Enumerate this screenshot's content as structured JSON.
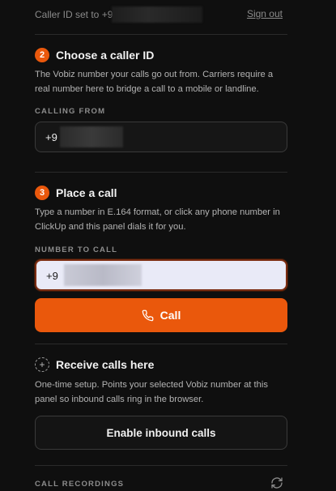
{
  "header": {
    "caller_id_text": "Caller ID set to +91",
    "sign_out_label": "Sign out"
  },
  "step_caller": {
    "number": "2",
    "title": "Choose a caller ID",
    "description": "The Vobiz number your calls go out from. Carriers require a real number here to bridge a call to a mobile or landline.",
    "field_label": "CALLING FROM",
    "value": "+9"
  },
  "step_call": {
    "number": "3",
    "title": "Place a call",
    "description": "Type a number in E.164 format, or click any phone number in ClickUp and this panel dials it for you.",
    "field_label": "NUMBER TO CALL",
    "value": "+9",
    "call_label": "Call"
  },
  "step_receive": {
    "number": "+",
    "title": "Receive calls here",
    "description": "One-time setup. Points your selected Vobiz number at this panel so inbound calls ring in the browser.",
    "button_label": "Enable inbound calls"
  },
  "recordings": {
    "label": "CALL RECORDINGS"
  },
  "colors": {
    "accent": "#ea580c",
    "background": "#0f0f0f",
    "input_focus_bg": "#e9eaf7"
  },
  "icons": {
    "call": "phone-icon",
    "refresh": "refresh-icon"
  }
}
